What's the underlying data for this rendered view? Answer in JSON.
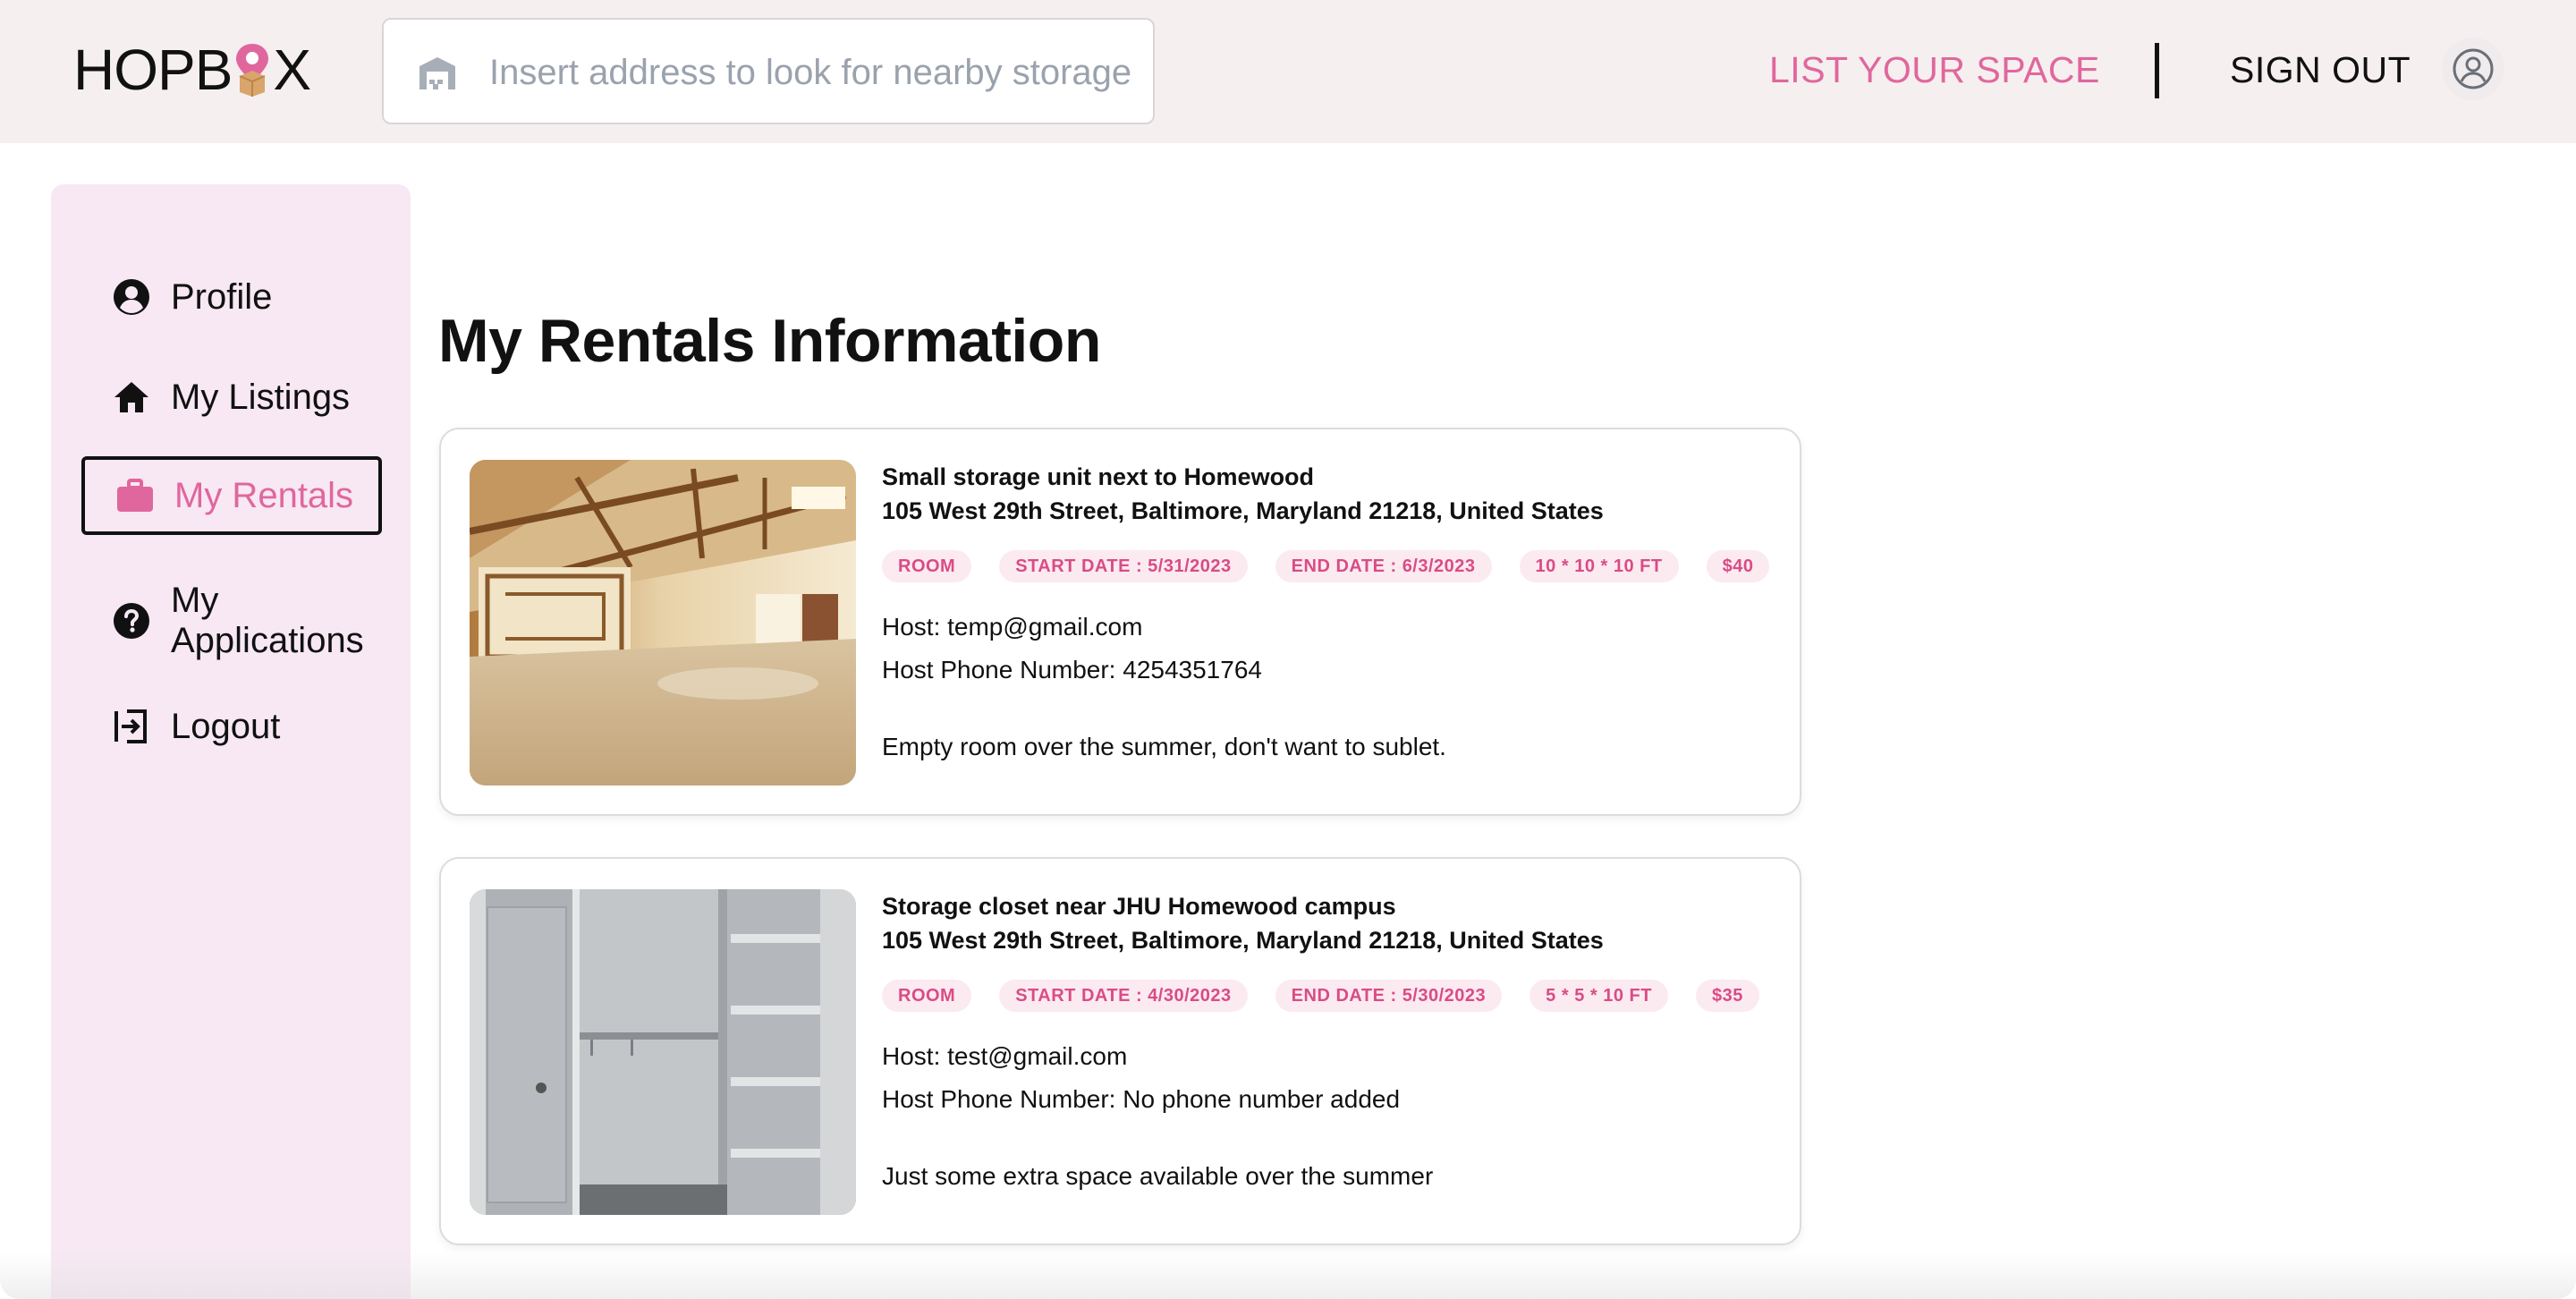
{
  "header": {
    "logo_text_left": "HOPB",
    "logo_text_right": "X",
    "search_placeholder": "Insert address to look for nearby storage",
    "search_value": "",
    "list_space_label": "LIST YOUR SPACE",
    "sign_out_label": "SIGN OUT"
  },
  "sidebar": {
    "items": [
      {
        "label": "Profile",
        "icon": "account-circle-icon"
      },
      {
        "label": "My Listings",
        "icon": "home-icon"
      },
      {
        "label": "My Rentals",
        "icon": "briefcase-icon",
        "active": true
      },
      {
        "label": "My Applications",
        "icon": "help-circle-icon"
      },
      {
        "label": "Logout",
        "icon": "logout-icon"
      }
    ]
  },
  "main": {
    "title": "My Rentals Information",
    "rentals": [
      {
        "title": "Small storage unit next to Homewood",
        "address": "105 West 29th Street, Baltimore, Maryland 21218, United States",
        "tags": [
          "ROOM",
          "START DATE : 5/31/2023",
          "END DATE : 6/3/2023",
          "10 * 10 * 10 FT",
          "$40"
        ],
        "host": "Host: temp@gmail.com",
        "phone": "Host Phone Number: 4254351764",
        "description": "Empty room over the summer, don't want to sublet."
      },
      {
        "title": "Storage closet near JHU Homewood campus",
        "address": "105 West 29th Street, Baltimore, Maryland 21218, United States",
        "tags": [
          "ROOM",
          "START DATE : 4/30/2023",
          "END DATE : 5/30/2023",
          "5 * 5 * 10 FT",
          "$35"
        ],
        "host": "Host: test@gmail.com",
        "phone": "Host Phone Number: No phone number added",
        "description": "Just some extra space available over the summer"
      }
    ]
  },
  "colors": {
    "accent": "#e0679d",
    "header_bg": "#f6eff0",
    "sidebar_bg": "#f7e8f3",
    "tag_bg": "#fceaf1",
    "tag_text": "#d94c86"
  }
}
